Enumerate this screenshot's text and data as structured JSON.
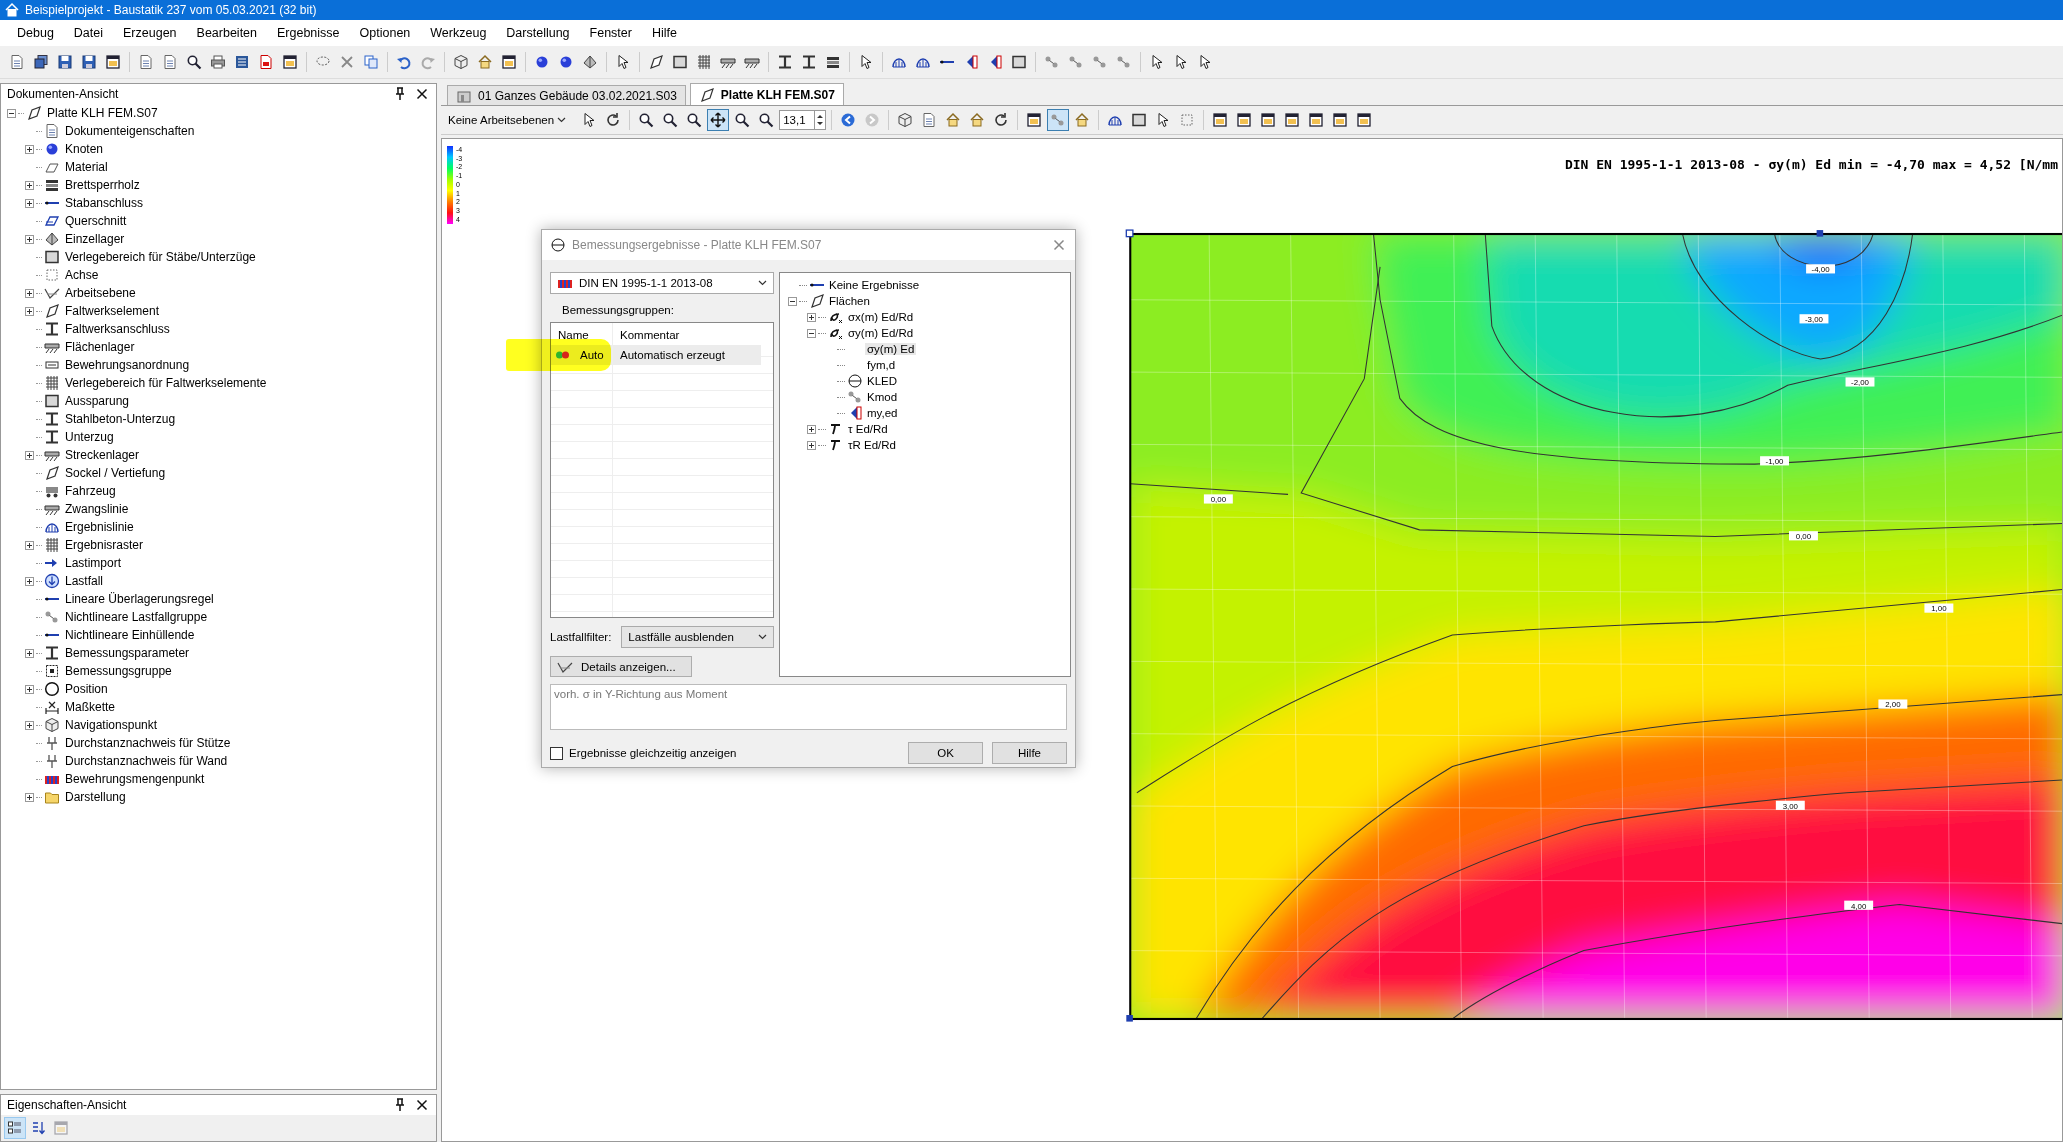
{
  "window": {
    "title": "Beispielprojekt - Baustatik 237 vom 05.03.2021 (32 bit)"
  },
  "menu": [
    "Debug",
    "Datei",
    "Erzeugen",
    "Bearbeiten",
    "Ergebnisse",
    "Optionen",
    "Werkzeug",
    "Darstellung",
    "Fenster",
    "Hilfe"
  ],
  "document_panel": {
    "title": "Dokumenten-Ansicht",
    "tree": [
      {
        "label": "Platte KLH FEM.S07",
        "expanded": true,
        "children": [
          {
            "label": "Dokumenteigenschaften"
          },
          {
            "label": "Knoten",
            "expanded": false
          },
          {
            "label": "Material"
          },
          {
            "label": "Brettsperrholz",
            "expanded": false
          },
          {
            "label": "Stabanschluss",
            "expanded": false
          },
          {
            "label": "Querschnitt"
          },
          {
            "label": "Einzellager",
            "expanded": false
          },
          {
            "label": "Verlegebereich für Stäbe/Unterzüge"
          },
          {
            "label": "Achse"
          },
          {
            "label": "Arbeitsebene",
            "expanded": false
          },
          {
            "label": "Faltwerkselement",
            "expanded": false
          },
          {
            "label": "Faltwerksanschluss"
          },
          {
            "label": "Flächenlager"
          },
          {
            "label": "Bewehrungsanordnung"
          },
          {
            "label": "Verlegebereich für Faltwerkselemente"
          },
          {
            "label": "Aussparung"
          },
          {
            "label": "Stahlbeton-Unterzug"
          },
          {
            "label": "Unterzug"
          },
          {
            "label": "Streckenlager",
            "expanded": false
          },
          {
            "label": "Sockel / Vertiefung"
          },
          {
            "label": "Fahrzeug"
          },
          {
            "label": "Zwangslinie"
          },
          {
            "label": "Ergebnislinie"
          },
          {
            "label": "Ergebnisraster",
            "expanded": false
          },
          {
            "label": "Lastimport"
          },
          {
            "label": "Lastfall",
            "expanded": false
          },
          {
            "label": "Lineare Überlagerungsregel"
          },
          {
            "label": "Nichtlineare Lastfallgruppe"
          },
          {
            "label": "Nichtlineare Einhüllende"
          },
          {
            "label": "Bemessungsparameter",
            "expanded": false
          },
          {
            "label": "Bemessungsgruppe"
          },
          {
            "label": "Position",
            "expanded": false
          },
          {
            "label": "Maßkette"
          },
          {
            "label": "Navigationspunkt",
            "expanded": false
          },
          {
            "label": "Durchstanznachweis für Stütze"
          },
          {
            "label": "Durchstanznachweis für Wand"
          },
          {
            "label": "Bewehrungsmengenpunkt"
          },
          {
            "label": "Darstellung",
            "expanded": false
          }
        ]
      }
    ]
  },
  "properties_panel": {
    "title": "Eigenschaften-Ansicht",
    "tools": [
      {
        "pressed": true,
        "disabled": false
      },
      {
        "pressed": false,
        "disabled": false
      },
      {
        "pressed": false,
        "disabled": true
      }
    ]
  },
  "tabs": [
    {
      "label": "01 Ganzes Gebäude 03.02.2021.S03",
      "selected": false
    },
    {
      "label": "Platte KLH FEM.S07",
      "selected": true
    }
  ],
  "view_toolbar": {
    "workplane": "Keine Arbeitsebenen",
    "zoom": "13,1",
    "tools": [
      {
        "pressed": false
      },
      {
        "pressed": false
      },
      {
        "pressed": false
      },
      {
        "pressed": false
      },
      {
        "pressed": false
      },
      {
        "pressed": true
      },
      {
        "pressed": false
      },
      {
        "pressed": false
      },
      {
        "pressed": false
      },
      {
        "pressed": false
      },
      {
        "pressed": false
      },
      {
        "pressed": false
      },
      {
        "pressed": false
      },
      {
        "pressed": false
      },
      {
        "pressed": false
      },
      {
        "pressed": false
      },
      {
        "pressed": true
      },
      {
        "pressed": false
      },
      {
        "pressed": false
      },
      {
        "pressed": false
      },
      {
        "pressed": false
      },
      {
        "pressed": false
      },
      {
        "pressed": false
      },
      {
        "pressed": false
      },
      {
        "pressed": false
      },
      {
        "pressed": false
      },
      {
        "pressed": false
      },
      {
        "pressed": false
      },
      {
        "pressed": false
      }
    ]
  },
  "result_view": {
    "legend": [
      "-4",
      "-3",
      "-2",
      "-1",
      "0",
      "1",
      "2",
      "3",
      "4"
    ],
    "heading": "DIN EN 1995-1-1 2013-08 - σy(m) Ed min = -4,70 max = 4,52 [N/mm",
    "contour_labels": [
      "-4,00",
      "-3,00",
      "-2,00",
      "-1,00",
      "0,00",
      "0,00",
      "1,00",
      "2,00",
      "3,00",
      "4,00"
    ]
  },
  "dialog": {
    "title": "Bemessungsergebnisse - Platte KLH FEM.S07",
    "standard": "DIN EN 1995-1-1 2013-08",
    "groups_label": "Bemessungsgruppen:",
    "columns": [
      "Name",
      "Kommentar"
    ],
    "rows": [
      {
        "name": "Auto",
        "comment": "Automatisch erzeugt",
        "selected": true
      }
    ],
    "filter_label": "Lastfallfilter:",
    "filter_value": "Lastfälle ausblenden",
    "details_button": "Details anzeigen...",
    "tree": [
      {
        "label": "Keine Ergebnisse",
        "selected": false
      },
      {
        "label": "Flächen",
        "selected": false,
        "expanded": true,
        "children": [
          {
            "label": "σx(m) Ed/Rd",
            "selected": false,
            "expanded": false
          },
          {
            "label": "σy(m) Ed/Rd",
            "selected": false,
            "expanded": true,
            "children": [
              {
                "label": "σy(m) Ed",
                "selected": true
              },
              {
                "label": "fym,d",
                "selected": false
              },
              {
                "label": "KLED",
                "selected": false
              },
              {
                "label": "Kmod",
                "selected": false
              },
              {
                "label": "my,ed",
                "selected": false
              }
            ]
          },
          {
            "label": "τ Ed/Rd",
            "selected": false,
            "expanded": false
          },
          {
            "label": "τR Ed/Rd",
            "selected": false,
            "expanded": false
          }
        ]
      }
    ],
    "description": "vorh. σ in Y-Richtung aus Moment",
    "simultaneous": {
      "label": "Ergebnisse gleichzeitig anzeigen",
      "checked": false
    },
    "buttons": [
      "OK",
      "Hilfe"
    ]
  }
}
